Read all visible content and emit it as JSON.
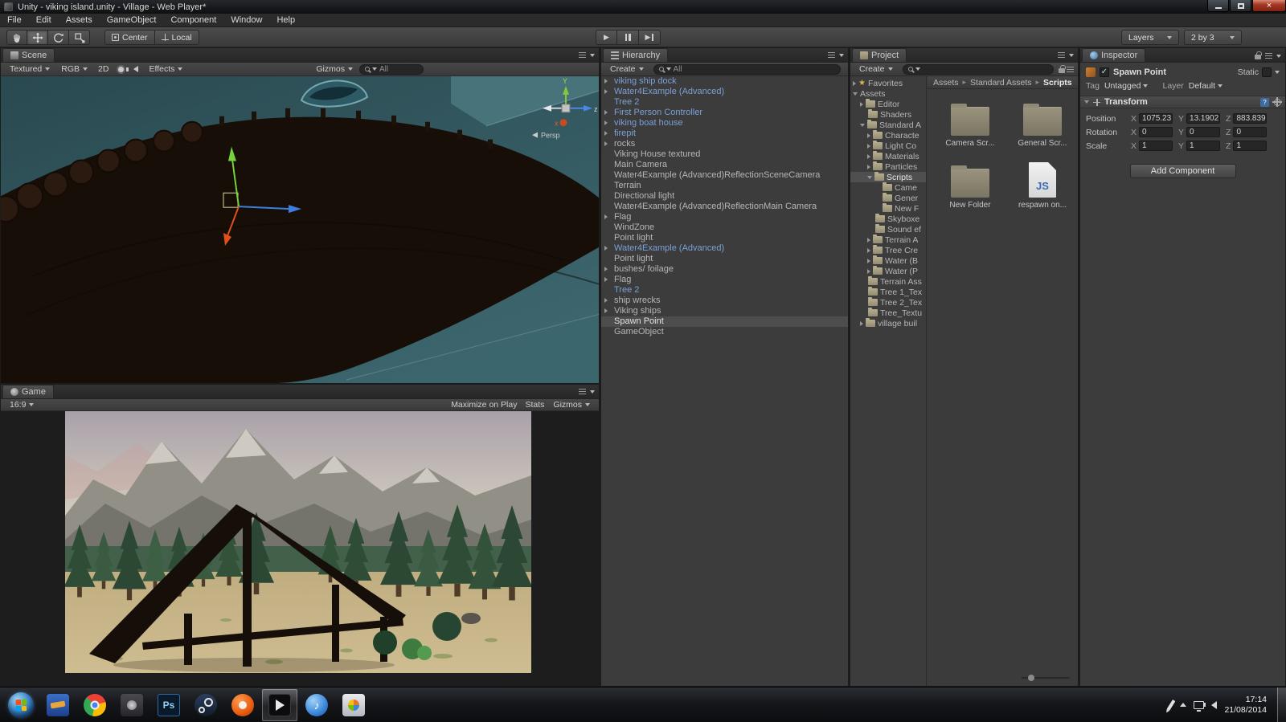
{
  "window": {
    "title": "Unity - viking island.unity - Village - Web Player*"
  },
  "menubar": {
    "items": [
      "File",
      "Edit",
      "Assets",
      "GameObject",
      "Component",
      "Window",
      "Help"
    ]
  },
  "toolbar": {
    "pivot_label": "Center",
    "space_label": "Local",
    "layers_label": "Layers",
    "layout_label": "2 by 3"
  },
  "scene_panel": {
    "tab": "Scene",
    "shading_mode": "Textured",
    "render_mode": "RGB",
    "mode_2d": "2D",
    "effects_label": "Effects",
    "gizmos_label": "Gizmos",
    "search_value": "All",
    "gizmo_axes": {
      "y": "Y",
      "z": "z",
      "x": "x"
    },
    "projection_label": "Persp"
  },
  "game_panel": {
    "tab": "Game",
    "aspect": "16:9",
    "maximize_label": "Maximize on Play",
    "stats_label": "Stats",
    "gizmos_label": "Gizmos"
  },
  "hierarchy": {
    "tab": "Hierarchy",
    "create_label": "Create",
    "search_value": "All",
    "items": [
      {
        "label": "viking ship dock",
        "prefab": true,
        "arrow": true
      },
      {
        "label": "Water4Example (Advanced)",
        "prefab": true,
        "arrow": true
      },
      {
        "label": "Tree 2",
        "prefab": true,
        "arrow": false
      },
      {
        "label": "First Person Controller",
        "prefab": true,
        "arrow": true
      },
      {
        "label": "viking boat house",
        "prefab": true,
        "arrow": true
      },
      {
        "label": "firepit",
        "prefab": true,
        "arrow": true
      },
      {
        "label": "rocks",
        "prefab": false,
        "arrow": true
      },
      {
        "label": "Viking House textured",
        "prefab": false,
        "arrow": false
      },
      {
        "label": "Main Camera",
        "prefab": false,
        "arrow": false
      },
      {
        "label": "Water4Example (Advanced)ReflectionSceneCamera",
        "prefab": false,
        "arrow": false
      },
      {
        "label": "Terrain",
        "prefab": false,
        "arrow": false
      },
      {
        "label": "Directional light",
        "prefab": false,
        "arrow": false
      },
      {
        "label": "Water4Example (Advanced)ReflectionMain Camera",
        "prefab": false,
        "arrow": false
      },
      {
        "label": "Flag",
        "prefab": false,
        "arrow": true
      },
      {
        "label": "WindZone",
        "prefab": false,
        "arrow": false
      },
      {
        "label": "Point light",
        "prefab": false,
        "arrow": false
      },
      {
        "label": "Water4Example (Advanced)",
        "prefab": true,
        "arrow": true
      },
      {
        "label": "Point light",
        "prefab": false,
        "arrow": false
      },
      {
        "label": "bushes/ foilage",
        "prefab": false,
        "arrow": true
      },
      {
        "label": "Flag",
        "prefab": false,
        "arrow": true
      },
      {
        "label": "Tree 2",
        "prefab": true,
        "arrow": false
      },
      {
        "label": "ship wrecks",
        "prefab": false,
        "arrow": true
      },
      {
        "label": "Viking ships",
        "prefab": false,
        "arrow": true
      },
      {
        "label": "Spawn Point",
        "prefab": false,
        "arrow": false,
        "selected": true
      },
      {
        "label": "GameObject",
        "prefab": false,
        "arrow": false
      }
    ]
  },
  "project": {
    "tab": "Project",
    "create_label": "Create",
    "js_badge": "JS",
    "tree": [
      {
        "label": "Favorites",
        "level": 0,
        "arrow": "right",
        "icon": "star"
      },
      {
        "label": "Assets",
        "level": 0,
        "arrow": "down",
        "icon": null
      },
      {
        "label": "Editor",
        "level": 1,
        "arrow": "right",
        "icon": "folder"
      },
      {
        "label": "Shaders",
        "level": 1,
        "arrow": null,
        "icon": "folder"
      },
      {
        "label": "Standard A",
        "level": 1,
        "arrow": "down",
        "icon": "folder"
      },
      {
        "label": "Characte",
        "level": 2,
        "arrow": "right",
        "icon": "folder"
      },
      {
        "label": "Light Co",
        "level": 2,
        "arrow": "right",
        "icon": "folder"
      },
      {
        "label": "Materials",
        "level": 2,
        "arrow": "right",
        "icon": "folder"
      },
      {
        "label": "Particles",
        "level": 2,
        "arrow": "right",
        "icon": "folder"
      },
      {
        "label": "Scripts",
        "level": 2,
        "arrow": "down",
        "icon": "folder",
        "selected": true
      },
      {
        "label": "Came",
        "level": 3,
        "arrow": null,
        "icon": "folder"
      },
      {
        "label": "Gener",
        "level": 3,
        "arrow": null,
        "icon": "folder"
      },
      {
        "label": "New F",
        "level": 3,
        "arrow": null,
        "icon": "folder"
      },
      {
        "label": "Skyboxe",
        "level": 2,
        "arrow": null,
        "icon": "folder"
      },
      {
        "label": "Sound ef",
        "level": 2,
        "arrow": null,
        "icon": "folder"
      },
      {
        "label": "Terrain A",
        "level": 2,
        "arrow": "right",
        "icon": "folder"
      },
      {
        "label": "Tree Cre",
        "level": 2,
        "arrow": "right",
        "icon": "folder"
      },
      {
        "label": "Water (B",
        "level": 2,
        "arrow": "right",
        "icon": "folder"
      },
      {
        "label": "Water (P",
        "level": 2,
        "arrow": "right",
        "icon": "folder"
      },
      {
        "label": "Terrain Ass",
        "level": 1,
        "arrow": null,
        "icon": "folder"
      },
      {
        "label": "Tree 1_Tex",
        "level": 1,
        "arrow": null,
        "icon": "folder"
      },
      {
        "label": "Tree 2_Tex",
        "level": 1,
        "arrow": null,
        "icon": "folder"
      },
      {
        "label": "Tree_Textu",
        "level": 1,
        "arrow": null,
        "icon": "folder"
      },
      {
        "label": "village buil",
        "level": 1,
        "arrow": "right",
        "icon": "folder"
      }
    ],
    "breadcrumb": [
      "Assets",
      "Standard Assets",
      "Scripts"
    ],
    "files": [
      {
        "name": "Camera Scr...",
        "kind": "folder"
      },
      {
        "name": "General Scr...",
        "kind": "folder"
      },
      {
        "name": "New Folder",
        "kind": "folder"
      },
      {
        "name": "respawn on...",
        "kind": "js"
      }
    ]
  },
  "inspector": {
    "tab": "Inspector",
    "object_name": "Spawn Point",
    "static_label": "Static",
    "tag_label": "Tag",
    "tag_value": "Untagged",
    "layer_label": "Layer",
    "layer_value": "Default",
    "transform": {
      "title": "Transform",
      "axis_labels": [
        "X",
        "Y",
        "Z"
      ],
      "rows": [
        {
          "label": "Position",
          "x": "1075.23",
          "y": "13.1902",
          "z": "883.839"
        },
        {
          "label": "Rotation",
          "x": "0",
          "y": "0",
          "z": "0"
        },
        {
          "label": "Scale",
          "x": "1",
          "y": "1",
          "z": "1"
        }
      ]
    },
    "add_component_label": "Add Component"
  },
  "taskbar": {
    "icons": [
      "start",
      "bluej",
      "chrome",
      "app-dark",
      "photoshop",
      "steam",
      "app-orange",
      "unity",
      "itunes",
      "media"
    ],
    "active_icon": "unity",
    "photoshop_label": "Ps",
    "clock": {
      "time": "17:14",
      "date": "21/08/2014"
    }
  }
}
